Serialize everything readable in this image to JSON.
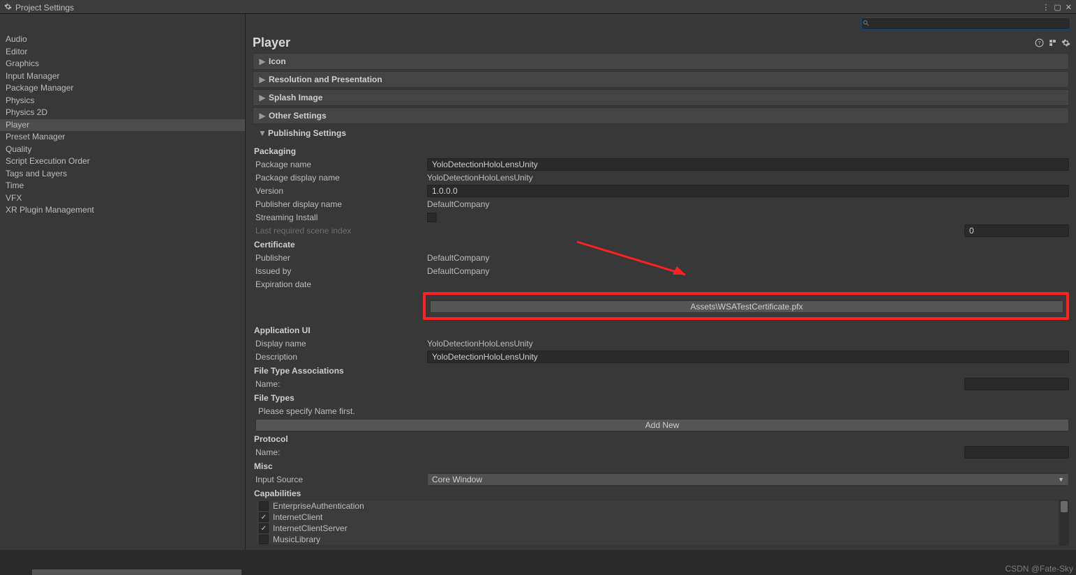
{
  "window": {
    "title": "Project Settings"
  },
  "sidebar": {
    "items": [
      "Audio",
      "Editor",
      "Graphics",
      "Input Manager",
      "Package Manager",
      "Physics",
      "Physics 2D",
      "Player",
      "Preset Manager",
      "Quality",
      "Script Execution Order",
      "Tags and Layers",
      "Time",
      "VFX",
      "XR Plugin Management"
    ],
    "selected": "Player"
  },
  "main": {
    "title": "Player",
    "search_placeholder": "",
    "foldouts": {
      "icon": "Icon",
      "resolution": "Resolution and Presentation",
      "splash": "Splash Image",
      "other": "Other Settings",
      "publishing": "Publishing Settings"
    },
    "packaging": {
      "header": "Packaging",
      "package_name_label": "Package name",
      "package_name": "YoloDetectionHoloLensUnity",
      "package_display_label": "Package display name",
      "package_display": "YoloDetectionHoloLensUnity",
      "version_label": "Version",
      "version": "1.0.0.0",
      "publisher_display_label": "Publisher display name",
      "publisher_display": "DefaultCompany",
      "streaming_label": "Streaming Install",
      "streaming_checked": false,
      "last_scene_label": "Last required scene index",
      "last_scene": "0"
    },
    "certificate": {
      "header": "Certificate",
      "publisher_label": "Publisher",
      "publisher": "DefaultCompany",
      "issued_label": "Issued by",
      "issued": "DefaultCompany",
      "expiration_label": "Expiration date",
      "cert_path": "Assets\\WSATestCertificate.pfx"
    },
    "appui": {
      "header": "Application UI",
      "display_label": "Display name",
      "display": "YoloDetectionHoloLensUnity",
      "description_label": "Description",
      "description": "YoloDetectionHoloLensUnity"
    },
    "fta": {
      "header": "File Type Associations",
      "name_label": "Name:",
      "name": ""
    },
    "filetypes": {
      "header": "File Types",
      "message": "Please specify Name first.",
      "add_new": "Add New"
    },
    "protocol": {
      "header": "Protocol",
      "name_label": "Name:",
      "name": ""
    },
    "misc": {
      "header": "Misc",
      "input_source_label": "Input Source",
      "input_source": "Core Window",
      "capabilities_label": "Capabilities",
      "capabilities": [
        {
          "label": "EnterpriseAuthentication",
          "checked": false
        },
        {
          "label": "InternetClient",
          "checked": true
        },
        {
          "label": "InternetClientServer",
          "checked": true
        },
        {
          "label": "MusicLibrary",
          "checked": false
        }
      ]
    }
  },
  "watermark": "CSDN @Fate-Sky"
}
